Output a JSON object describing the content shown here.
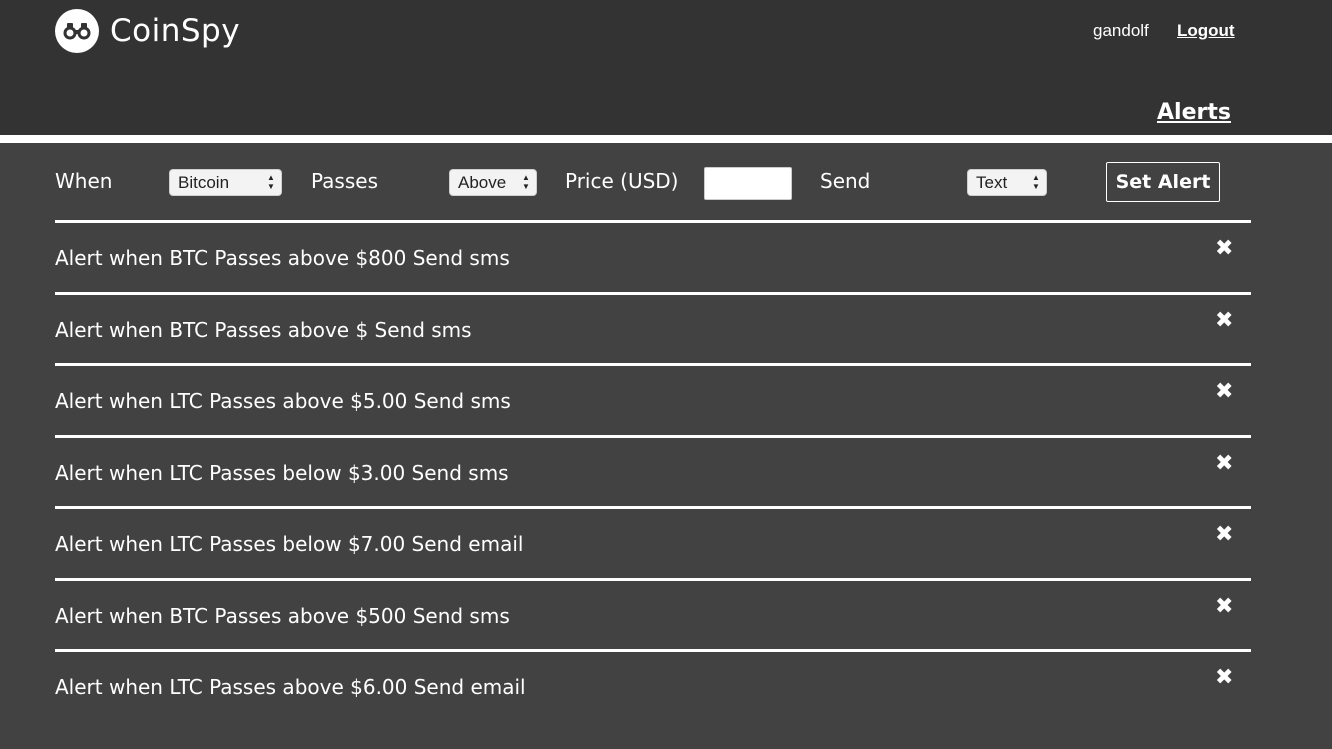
{
  "header": {
    "brand": "CoinSpy",
    "username": "gandolf",
    "logout_label": "Logout",
    "nav_alerts": "Alerts"
  },
  "form": {
    "when_label": "When",
    "coin_selected": "Bitcoin",
    "passes_label": "Passes",
    "direction_selected": "Above",
    "price_label": "Price (USD)",
    "price_value": "",
    "send_label": "Send",
    "method_selected": "Text",
    "submit_label": "Set Alert"
  },
  "alerts": [
    {
      "text": "Alert when BTC Passes above $800 Send sms"
    },
    {
      "text": "Alert when BTC Passes above $ Send sms"
    },
    {
      "text": "Alert when LTC Passes above $5.00 Send sms"
    },
    {
      "text": "Alert when LTC Passes below $3.00 Send sms"
    },
    {
      "text": "Alert when LTC Passes below $7.00 Send email"
    },
    {
      "text": "Alert when BTC Passes above $500 Send sms"
    },
    {
      "text": "Alert when LTC Passes above $6.00 Send email"
    }
  ],
  "delete_glyph": "✖",
  "colors": {
    "header_bg": "#333333",
    "page_bg": "#424242",
    "accent": "#ffffff"
  }
}
